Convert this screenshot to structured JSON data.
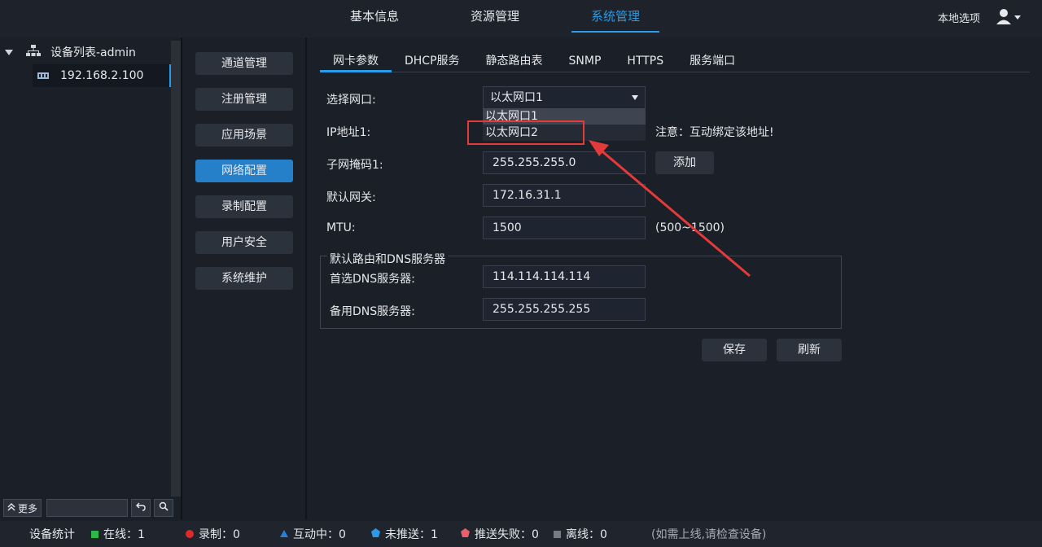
{
  "topnav": {
    "tabs": [
      {
        "label": "基本信息",
        "active": false
      },
      {
        "label": "资源管理",
        "active": false
      },
      {
        "label": "系统管理",
        "active": true
      }
    ],
    "local_options": "本地选项"
  },
  "tree": {
    "root_label": "设备列表-admin",
    "node_label": "192.168.2.100",
    "more_label": "更多"
  },
  "side_menu": {
    "items": [
      {
        "label": "通道管理",
        "active": false
      },
      {
        "label": "注册管理",
        "active": false
      },
      {
        "label": "应用场景",
        "active": false
      },
      {
        "label": "网络配置",
        "active": true
      },
      {
        "label": "录制配置",
        "active": false
      },
      {
        "label": "用户安全",
        "active": false
      },
      {
        "label": "系统维护",
        "active": false
      }
    ]
  },
  "subtabs": [
    {
      "label": "网卡参数",
      "active": true
    },
    {
      "label": "DHCP服务",
      "active": false
    },
    {
      "label": "静态路由表",
      "active": false
    },
    {
      "label": "SNMP",
      "active": false
    },
    {
      "label": "HTTPS",
      "active": false
    },
    {
      "label": "服务端口",
      "active": false
    }
  ],
  "form": {
    "select_label": "选择网口:",
    "select_value": "以太网口1",
    "select_options": [
      "以太网口1",
      "以太网口2"
    ],
    "ip_label": "IP地址1:",
    "ip_note": "注意：互动绑定该地址!",
    "mask_label": "子网掩码1:",
    "mask_value": "255.255.255.0",
    "add_label": "添加",
    "gateway_label": "默认网关:",
    "gateway_value": "172.16.31.1",
    "mtu_label": "MTU:",
    "mtu_value": "1500",
    "mtu_range": "(500~1500)",
    "group_title": "默认路由和DNS服务器",
    "dns1_label": "首选DNS服务器:",
    "dns1_value": "114.114.114.114",
    "dns2_label": "备用DNS服务器:",
    "dns2_value": "255.255.255.255",
    "save_label": "保存",
    "refresh_label": "刷新"
  },
  "statusbar": {
    "stats_label": "设备统计",
    "online": "在线：1",
    "recording": "录制：0",
    "interacting": "互动中：0",
    "unpushed": "未推送：1",
    "push_failed": "推送失败：0",
    "offline": "离线：0",
    "note": "(如需上线,请检查设备)",
    "colors": {
      "online": "#2fb84a",
      "recording": "#e02a2a",
      "interacting": "#2a7fd6",
      "unpushed": "#2a9bea",
      "push_failed": "#e8606a",
      "offline": "#777b82"
    }
  },
  "annotation": {
    "highlight_color": "#e43a3a"
  }
}
